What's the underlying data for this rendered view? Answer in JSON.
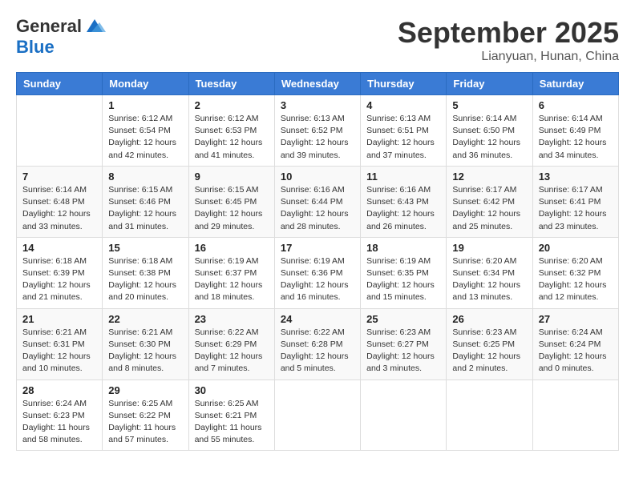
{
  "header": {
    "logo_general": "General",
    "logo_blue": "Blue",
    "month_year": "September 2025",
    "location": "Lianyuan, Hunan, China"
  },
  "weekdays": [
    "Sunday",
    "Monday",
    "Tuesday",
    "Wednesday",
    "Thursday",
    "Friday",
    "Saturday"
  ],
  "weeks": [
    [
      {
        "day": "",
        "info": ""
      },
      {
        "day": "1",
        "info": "Sunrise: 6:12 AM\nSunset: 6:54 PM\nDaylight: 12 hours\nand 42 minutes."
      },
      {
        "day": "2",
        "info": "Sunrise: 6:12 AM\nSunset: 6:53 PM\nDaylight: 12 hours\nand 41 minutes."
      },
      {
        "day": "3",
        "info": "Sunrise: 6:13 AM\nSunset: 6:52 PM\nDaylight: 12 hours\nand 39 minutes."
      },
      {
        "day": "4",
        "info": "Sunrise: 6:13 AM\nSunset: 6:51 PM\nDaylight: 12 hours\nand 37 minutes."
      },
      {
        "day": "5",
        "info": "Sunrise: 6:14 AM\nSunset: 6:50 PM\nDaylight: 12 hours\nand 36 minutes."
      },
      {
        "day": "6",
        "info": "Sunrise: 6:14 AM\nSunset: 6:49 PM\nDaylight: 12 hours\nand 34 minutes."
      }
    ],
    [
      {
        "day": "7",
        "info": "Sunrise: 6:14 AM\nSunset: 6:48 PM\nDaylight: 12 hours\nand 33 minutes."
      },
      {
        "day": "8",
        "info": "Sunrise: 6:15 AM\nSunset: 6:46 PM\nDaylight: 12 hours\nand 31 minutes."
      },
      {
        "day": "9",
        "info": "Sunrise: 6:15 AM\nSunset: 6:45 PM\nDaylight: 12 hours\nand 29 minutes."
      },
      {
        "day": "10",
        "info": "Sunrise: 6:16 AM\nSunset: 6:44 PM\nDaylight: 12 hours\nand 28 minutes."
      },
      {
        "day": "11",
        "info": "Sunrise: 6:16 AM\nSunset: 6:43 PM\nDaylight: 12 hours\nand 26 minutes."
      },
      {
        "day": "12",
        "info": "Sunrise: 6:17 AM\nSunset: 6:42 PM\nDaylight: 12 hours\nand 25 minutes."
      },
      {
        "day": "13",
        "info": "Sunrise: 6:17 AM\nSunset: 6:41 PM\nDaylight: 12 hours\nand 23 minutes."
      }
    ],
    [
      {
        "day": "14",
        "info": "Sunrise: 6:18 AM\nSunset: 6:39 PM\nDaylight: 12 hours\nand 21 minutes."
      },
      {
        "day": "15",
        "info": "Sunrise: 6:18 AM\nSunset: 6:38 PM\nDaylight: 12 hours\nand 20 minutes."
      },
      {
        "day": "16",
        "info": "Sunrise: 6:19 AM\nSunset: 6:37 PM\nDaylight: 12 hours\nand 18 minutes."
      },
      {
        "day": "17",
        "info": "Sunrise: 6:19 AM\nSunset: 6:36 PM\nDaylight: 12 hours\nand 16 minutes."
      },
      {
        "day": "18",
        "info": "Sunrise: 6:19 AM\nSunset: 6:35 PM\nDaylight: 12 hours\nand 15 minutes."
      },
      {
        "day": "19",
        "info": "Sunrise: 6:20 AM\nSunset: 6:34 PM\nDaylight: 12 hours\nand 13 minutes."
      },
      {
        "day": "20",
        "info": "Sunrise: 6:20 AM\nSunset: 6:32 PM\nDaylight: 12 hours\nand 12 minutes."
      }
    ],
    [
      {
        "day": "21",
        "info": "Sunrise: 6:21 AM\nSunset: 6:31 PM\nDaylight: 12 hours\nand 10 minutes."
      },
      {
        "day": "22",
        "info": "Sunrise: 6:21 AM\nSunset: 6:30 PM\nDaylight: 12 hours\nand 8 minutes."
      },
      {
        "day": "23",
        "info": "Sunrise: 6:22 AM\nSunset: 6:29 PM\nDaylight: 12 hours\nand 7 minutes."
      },
      {
        "day": "24",
        "info": "Sunrise: 6:22 AM\nSunset: 6:28 PM\nDaylight: 12 hours\nand 5 minutes."
      },
      {
        "day": "25",
        "info": "Sunrise: 6:23 AM\nSunset: 6:27 PM\nDaylight: 12 hours\nand 3 minutes."
      },
      {
        "day": "26",
        "info": "Sunrise: 6:23 AM\nSunset: 6:25 PM\nDaylight: 12 hours\nand 2 minutes."
      },
      {
        "day": "27",
        "info": "Sunrise: 6:24 AM\nSunset: 6:24 PM\nDaylight: 12 hours\nand 0 minutes."
      }
    ],
    [
      {
        "day": "28",
        "info": "Sunrise: 6:24 AM\nSunset: 6:23 PM\nDaylight: 11 hours\nand 58 minutes."
      },
      {
        "day": "29",
        "info": "Sunrise: 6:25 AM\nSunset: 6:22 PM\nDaylight: 11 hours\nand 57 minutes."
      },
      {
        "day": "30",
        "info": "Sunrise: 6:25 AM\nSunset: 6:21 PM\nDaylight: 11 hours\nand 55 minutes."
      },
      {
        "day": "",
        "info": ""
      },
      {
        "day": "",
        "info": ""
      },
      {
        "day": "",
        "info": ""
      },
      {
        "day": "",
        "info": ""
      }
    ]
  ]
}
